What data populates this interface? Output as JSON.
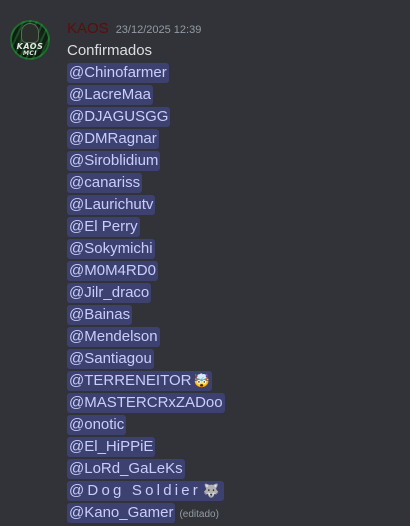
{
  "message": {
    "author": "KAOS",
    "timestamp": "23/12/2025 12:39",
    "avatar": {
      "text_line1": "KAOS",
      "text_line2": "MCI"
    },
    "heading": "Confirmados",
    "mentions": [
      {
        "label": "@Chinofarmer"
      },
      {
        "label": "@LacreMaa"
      },
      {
        "label": "@DJAGUSGG"
      },
      {
        "label": "@DMRagnar"
      },
      {
        "label": "@Siroblidium"
      },
      {
        "label": "@canariss"
      },
      {
        "label": "@Laurichutv"
      },
      {
        "label": "@El Perry"
      },
      {
        "label": "@Sokymichi"
      },
      {
        "label": "@M0M4RD0"
      },
      {
        "label": "@Jilr_draco"
      },
      {
        "label": "@Bainas"
      },
      {
        "label": "@Mendelson"
      },
      {
        "label": "@Santiagou"
      },
      {
        "label": "@TERRENEITOR",
        "emoji": "🤯"
      },
      {
        "label": "@MASTERCRxZADoo"
      },
      {
        "label": "@onotic"
      },
      {
        "label": "@El_HiPPiE"
      },
      {
        "label": "@LoRd_GaLeKs"
      },
      {
        "label": "@Dog Soldier",
        "emoji": "🐺",
        "spaced": true
      },
      {
        "label": "@Kano_Gamer"
      }
    ],
    "edited_label": "(editado)"
  },
  "colors": {
    "background": "#313338",
    "author": "#5c0d0d",
    "timestamp": "#949ba4",
    "text": "#dbdee1",
    "mention_bg": "rgba(88,101,242,0.30)",
    "mention_text": "#c9cdfb"
  }
}
